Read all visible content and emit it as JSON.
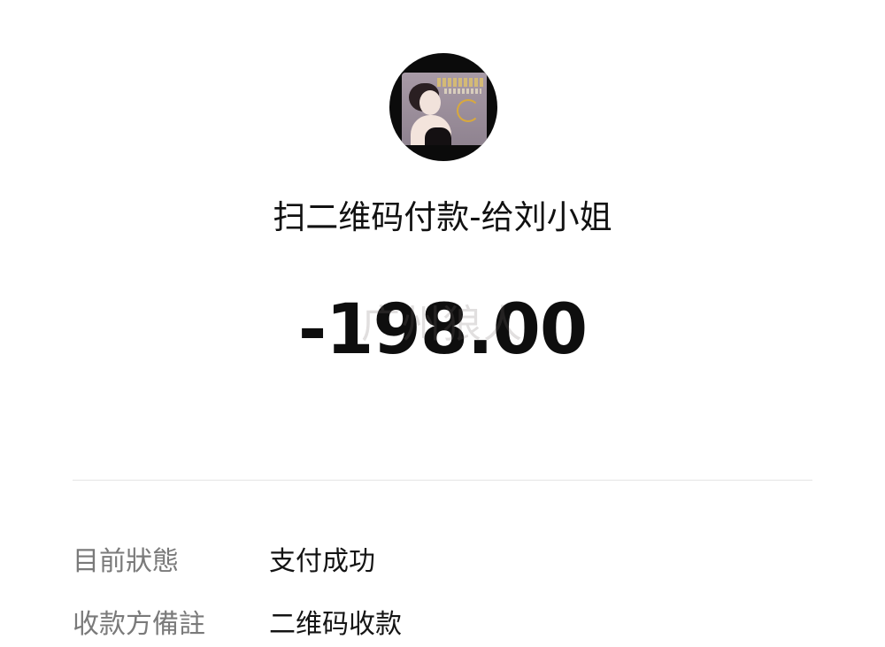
{
  "payment": {
    "title": "扫二维码付款-给刘小姐",
    "amount": "-198.00",
    "watermark": "广州狼人"
  },
  "details": [
    {
      "label": "目前狀態",
      "value": "支付成功"
    },
    {
      "label": "收款方備註",
      "value": "二维码收款"
    }
  ],
  "colors": {
    "background": "#ffffff",
    "text_primary": "#111111",
    "text_secondary": "#7a7a7a",
    "divider": "#e4e4e4",
    "avatar_ring": "#0b0b0b"
  },
  "icons": {
    "avatar": "merchant-avatar"
  }
}
